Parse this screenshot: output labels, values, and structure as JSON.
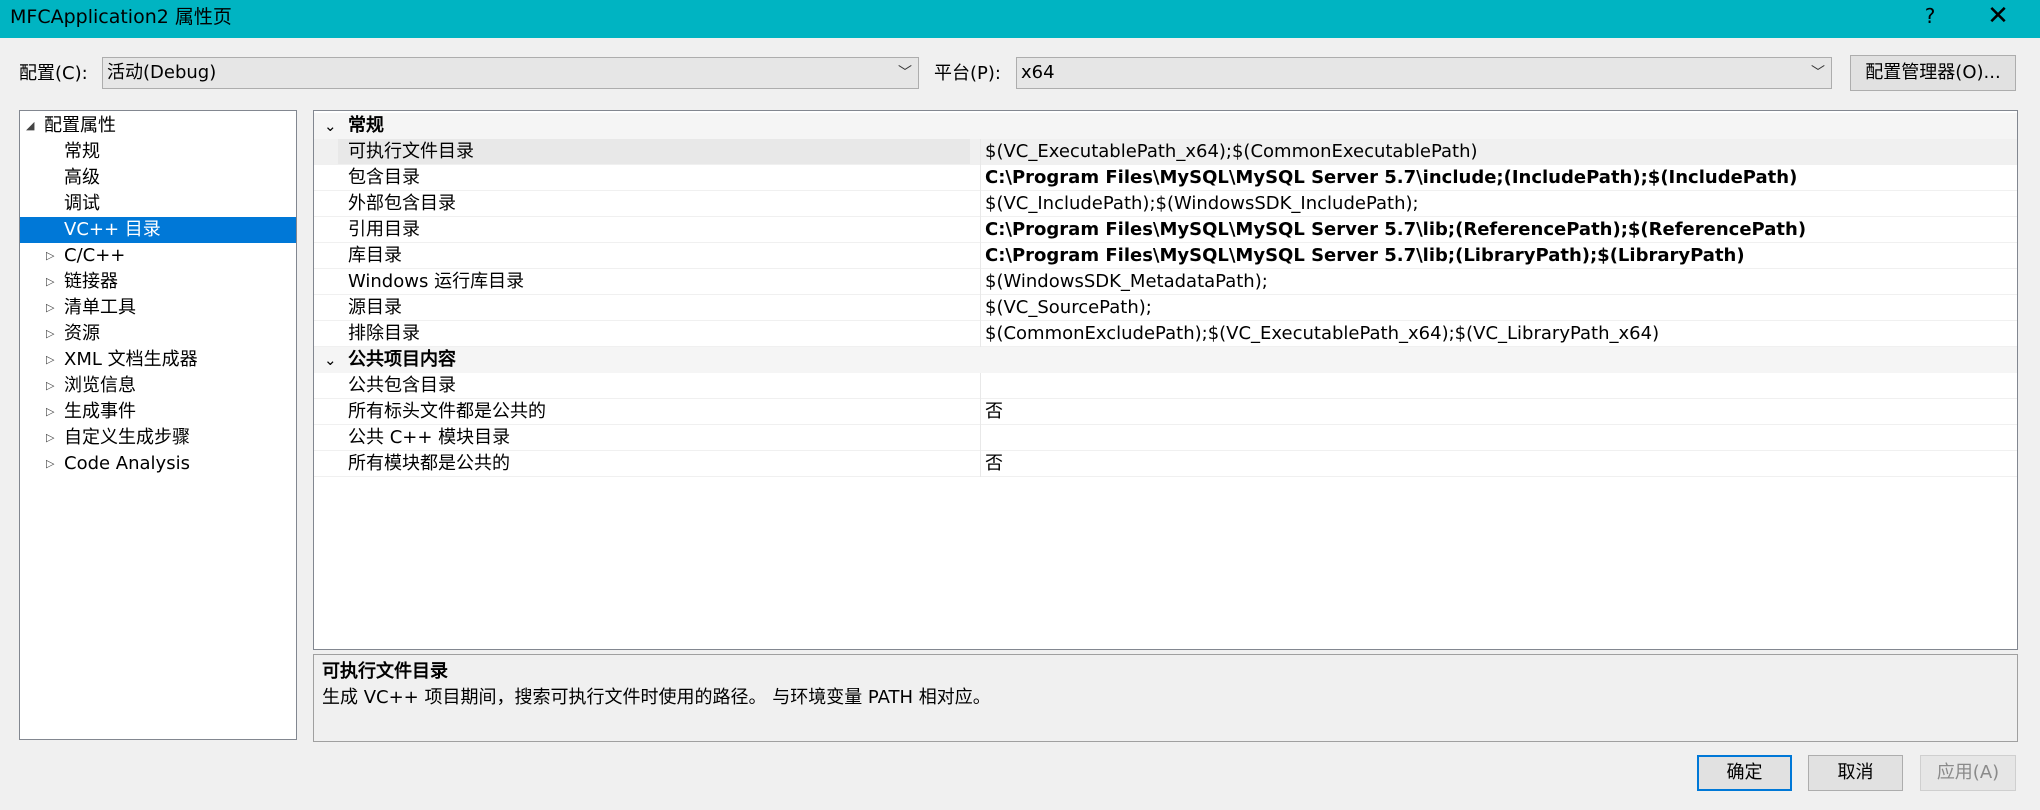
{
  "window": {
    "title": "MFCApplication2 属性页",
    "help_glyph": "?",
    "close_glyph": "✕"
  },
  "config_bar": {
    "config_label": "配置(C):",
    "config_value": "活动(Debug)",
    "platform_label": "平台(P):",
    "platform_value": "x64",
    "manager_button": "配置管理器(O)..."
  },
  "tree": {
    "items": [
      {
        "label": "配置属性",
        "twisty": "◢"
      },
      {
        "label": "常规"
      },
      {
        "label": "高级"
      },
      {
        "label": "调试"
      },
      {
        "label": "VC++ 目录",
        "selected": true
      },
      {
        "label": "C/C++",
        "twisty": "▷"
      },
      {
        "label": "链接器",
        "twisty": "▷"
      },
      {
        "label": "清单工具",
        "twisty": "▷"
      },
      {
        "label": "资源",
        "twisty": "▷"
      },
      {
        "label": "XML 文档生成器",
        "twisty": "▷"
      },
      {
        "label": "浏览信息",
        "twisty": "▷"
      },
      {
        "label": "生成事件",
        "twisty": "▷"
      },
      {
        "label": "自定义生成步骤",
        "twisty": "▷"
      },
      {
        "label": "Code Analysis",
        "twisty": "▷"
      }
    ]
  },
  "grid": {
    "categories": [
      {
        "name": "常规",
        "chevron": "⌄",
        "rows": [
          {
            "name": "可执行文件目录",
            "value": "$(VC_ExecutablePath_x64);$(CommonExecutablePath)",
            "bold": false,
            "highlight": true
          },
          {
            "name": "包含目录",
            "value": "C:\\Program Files\\MySQL\\MySQL Server 5.7\\include;(IncludePath);$(IncludePath)",
            "bold": true
          },
          {
            "name": "外部包含目录",
            "value": "$(VC_IncludePath);$(WindowsSDK_IncludePath);",
            "bold": false
          },
          {
            "name": "引用目录",
            "value": "C:\\Program Files\\MySQL\\MySQL Server 5.7\\lib;(ReferencePath);$(ReferencePath)",
            "bold": true
          },
          {
            "name": "库目录",
            "value": "C:\\Program Files\\MySQL\\MySQL Server 5.7\\lib;(LibraryPath);$(LibraryPath)",
            "bold": true
          },
          {
            "name": "Windows 运行库目录",
            "value": "$(WindowsSDK_MetadataPath);",
            "bold": false
          },
          {
            "name": "源目录",
            "value": "$(VC_SourcePath);",
            "bold": false
          },
          {
            "name": "排除目录",
            "value": "$(CommonExcludePath);$(VC_ExecutablePath_x64);$(VC_LibraryPath_x64)",
            "bold": false
          }
        ]
      },
      {
        "name": "公共项目内容",
        "chevron": "⌄",
        "rows": [
          {
            "name": "公共包含目录",
            "value": "",
            "bold": false
          },
          {
            "name": "所有标头文件都是公共的",
            "value": "否",
            "bold": false
          },
          {
            "name": "公共 C++ 模块目录",
            "value": "",
            "bold": false
          },
          {
            "name": "所有模块都是公共的",
            "value": "否",
            "bold": false
          }
        ]
      }
    ]
  },
  "description": {
    "title": "可执行文件目录",
    "text": "生成 VC++ 项目期间，搜索可执行文件时使用的路径。 与环境变量 PATH 相对应。"
  },
  "buttons": {
    "ok": "确定",
    "cancel": "取消",
    "apply": "应用(A)"
  }
}
